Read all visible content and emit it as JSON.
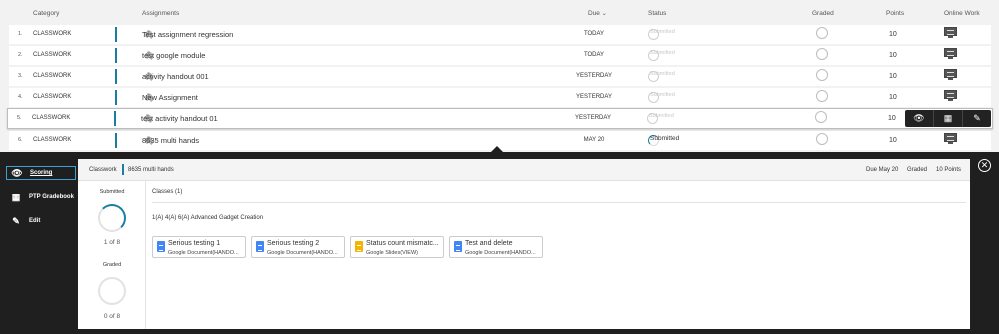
{
  "table": {
    "headers": {
      "category": "Category",
      "assignments": "Assignments",
      "due": "Due",
      "status": "Status",
      "graded": "Graded",
      "points": "Points",
      "online_work": "Online Work"
    },
    "rows": [
      {
        "num": "1.",
        "category": "CLASSWORK",
        "title": "Test assignment regression",
        "due": "TODAY",
        "status": "Submitted",
        "points": "10"
      },
      {
        "num": "2.",
        "category": "CLASSWORK",
        "title": "test google module",
        "due": "TODAY",
        "status": "Submitted",
        "points": "10"
      },
      {
        "num": "3.",
        "category": "CLASSWORK",
        "title": "activity handout 001",
        "due": "YESTERDAY",
        "status": "Submitted",
        "points": "10"
      },
      {
        "num": "4.",
        "category": "CLASSWORK",
        "title": "New Assignment",
        "due": "YESTERDAY",
        "status": "Submitted",
        "points": "10"
      },
      {
        "num": "5.",
        "category": "CLASSWORK",
        "title": "test activity handout 01",
        "due": "YESTERDAY",
        "status": "Submitted",
        "points": "10"
      },
      {
        "num": "6.",
        "category": "CLASSWORK",
        "title": "8635 multi hands",
        "due": "MAY 20",
        "status": "Submitted",
        "points": "10"
      }
    ]
  },
  "panel": {
    "sidebar": {
      "scoring": "Scoring",
      "gradebook": "PTP Gradebook",
      "edit": "Edit"
    },
    "breadcrumb": {
      "category": "Classwork",
      "title": "8635 multi hands",
      "due": "Due May 20",
      "graded": "Graded",
      "points": "10 Points"
    },
    "stats": {
      "submitted_label": "Submitted",
      "submitted_value": "1 of 8",
      "graded_label": "Graded",
      "graded_value": "0 of 8"
    },
    "classes_header": "Classes (1)",
    "class_name": "1(A) 4(A) 6(A) Advanced Gadget Creation",
    "cards": [
      {
        "title": "Serious testing 1",
        "subtitle": "Google Document(HANDO...",
        "icon": "google-doc-icon",
        "color": "#4285f4"
      },
      {
        "title": "Serious testing 2",
        "subtitle": "Google Document(HANDO...",
        "icon": "google-doc-icon",
        "color": "#4285f4"
      },
      {
        "title": "Status count mismatc...",
        "subtitle": "Google Slides(VIEW)",
        "icon": "google-slides-icon",
        "color": "#f4b400"
      },
      {
        "title": "Test and delete",
        "subtitle": "Google Document(HANDO...",
        "icon": "google-doc-icon",
        "color": "#4285f4"
      }
    ]
  },
  "colors": {
    "accent": "#1a7ea3",
    "panel_bg": "#1f1f1f",
    "active_border": "#3ba0d4"
  }
}
